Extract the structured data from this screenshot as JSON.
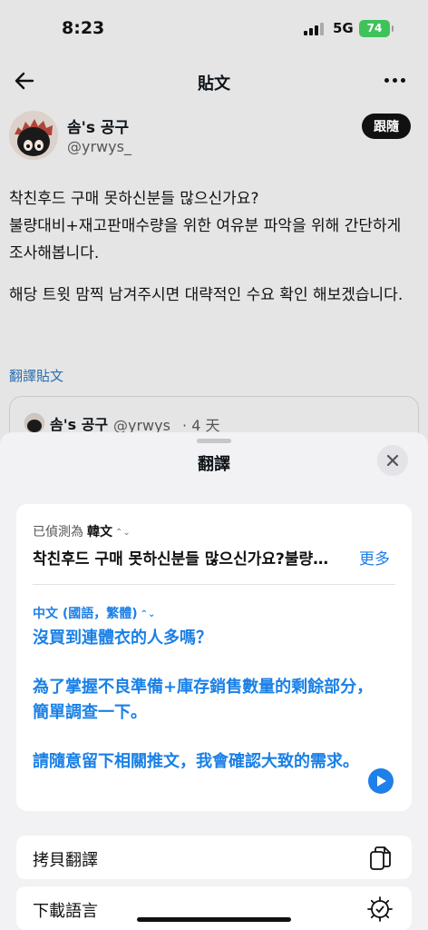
{
  "status_bar": {
    "time": "8:23",
    "network": "5G",
    "battery": "74"
  },
  "nav": {
    "title": "貼文"
  },
  "post": {
    "author_name": "솜's 공구",
    "author_handle": "@yrwys_",
    "follow_label": "跟隨",
    "paragraphs": [
      "착친후드 구매 못하신분들 많으신가요?\n불량대비+재고판매수량을 위한 여유분 파악을 위해 간단하게 조사해봅니다.",
      "해당 트윗 맘찍 남겨주시면 대략적인 수요 확인 해보겠습니다."
    ],
    "translate_link": "翻譯貼文",
    "quote": {
      "name": "솜's 공구",
      "meta": "@yrwys_ · 4 天"
    }
  },
  "sheet": {
    "title": "翻譯",
    "source": {
      "detected_label": "已偵測為",
      "language": "韓文",
      "text": "착친후드 구매 못하신분들 많으신가요?불량대비+재고판매수량을 위한 여유분 파악을 위해 간단하게 조사해봅니다.",
      "more_label": "更多"
    },
    "target": {
      "language": "中文 (國語，繁體)",
      "paragraphs": [
        "沒買到連體衣的人多嗎？",
        "為了掌握不良準備+庫存銷售數量的剩餘部分，簡單調查一下。",
        "請隨意留下相關推文，我會確認大致的需求。"
      ]
    },
    "actions": [
      {
        "label": "拷貝翻譯",
        "icon": "copy-icon"
      },
      {
        "label": "下載語言",
        "icon": "download-gear-icon"
      }
    ]
  },
  "colors": {
    "accent": "#1e80e8",
    "link": "#2a6fb0",
    "battery": "#3fc25a"
  }
}
